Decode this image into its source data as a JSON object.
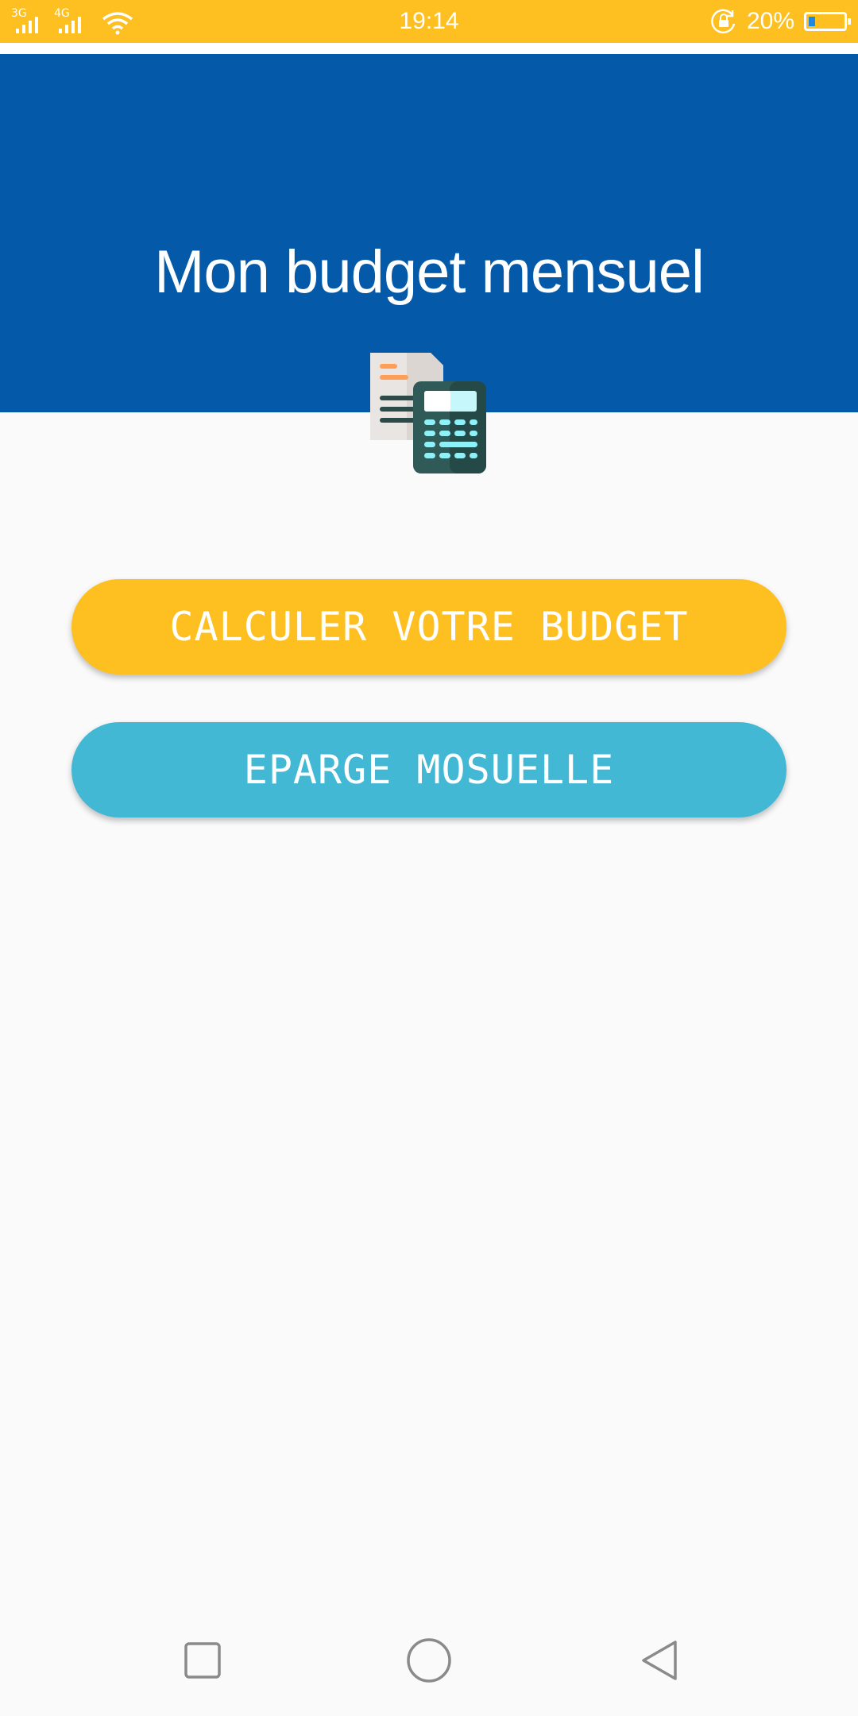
{
  "status_bar": {
    "network_1": "3G",
    "network_2": "4G",
    "time": "19:14",
    "battery_percent": "20%",
    "battery_level": 0.2,
    "icons": [
      "signal-3g-icon",
      "signal-4g-icon",
      "wifi-icon",
      "rotation-lock-icon",
      "battery-icon"
    ]
  },
  "header": {
    "title": "Mon budget mensuel",
    "icon": "budget-calculator-icon"
  },
  "buttons": {
    "calculate": "CALCULER VOTRE BUDGET",
    "savings": "EPARGE MOSUELLE"
  },
  "nav": {
    "icons": [
      "recents-icon",
      "home-icon",
      "back-icon"
    ]
  },
  "colors": {
    "status_bar": "#fec020",
    "header": "#045aa8",
    "button_calculate": "#fec020",
    "button_savings": "#42b8d5",
    "background": "#fafafa"
  }
}
